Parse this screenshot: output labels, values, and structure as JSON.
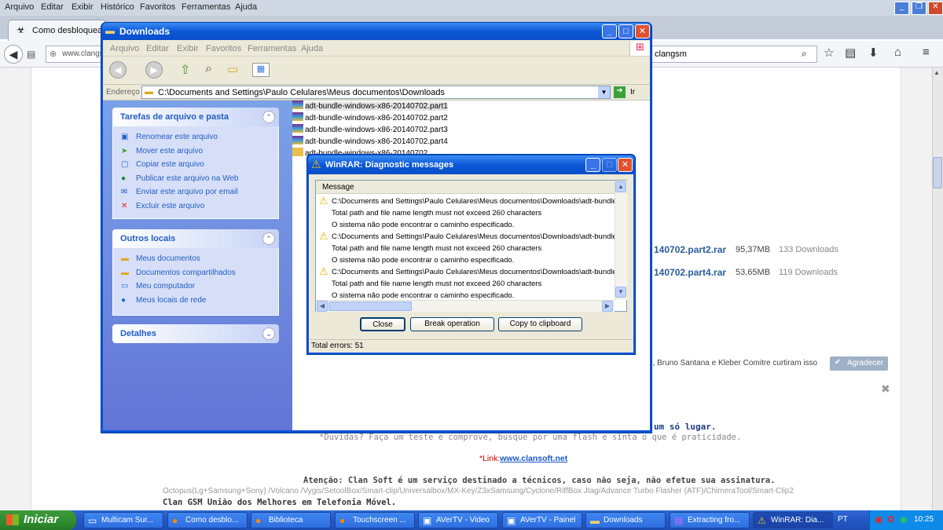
{
  "firefox": {
    "menu": [
      "Arquivo",
      "Editar",
      "Exibir",
      "Histórico",
      "Favoritos",
      "Ferramentas",
      "Ajuda"
    ],
    "tab_title": "Como desbloquear o",
    "url": "www.clangs",
    "search_value": "clangsm",
    "downloads": [
      {
        "name": "140702.part2.rar",
        "size": "95,37MB",
        "count": "133 Downloads"
      },
      {
        "name": "140702.part4.rar",
        "size": "53,65MB",
        "count": "119 Downloads"
      }
    ],
    "likes": "es, Bruno Santana e Kleber Comitre curtiram isso",
    "agradecer": "Agradecer",
    "page_lines": {
      "line1_tail": "um só lugar.",
      "line2": "*Duvidas? Faça um teste e comprove, busque por uma flash e sinta o que é praticidade.",
      "link_label": "*Link:",
      "link_url": "www.clansoft.net",
      "atencao": "Atenção: Clan Soft é um serviço destinado a técnicos, caso não seja, não efetue sua assinatura.",
      "tools": "Octopus(Lg+Samsung+Sony) /Volcano /Vygis/SetoolBox/Smart-clip/Universalbox/MX-Key/Z3xSamsung/Cyclone/RiffBox Jtag/Advance Turbo Flasher (ATF)/ChimeraTool/Smart-Clip2",
      "uniao": "Clan GSM União dos Melhores em Telefonia Móvel."
    }
  },
  "explorer": {
    "title": "Downloads",
    "menu": [
      "Arquivo",
      "Editar",
      "Exibir",
      "Favoritos",
      "Ferramentas",
      "Ajuda"
    ],
    "address_label": "Endereço",
    "address": "C:\\Documents and Settings\\Paulo Celulares\\Meus documentos\\Downloads",
    "go_label": "Ir",
    "tasks_title": "Tarefas de arquivo e pasta",
    "tasks": [
      "Renomear este arquivo",
      "Mover este arquivo",
      "Copiar este arquivo",
      "Publicar este arquivo na Web",
      "Enviar este arquivo por email",
      "Excluir este arquivo"
    ],
    "places_title": "Outros locais",
    "places": [
      "Meus documentos",
      "Documentos compartilhados",
      "Meu computador",
      "Meus locais de rede"
    ],
    "details_title": "Detalhes",
    "files": [
      "adt-bundle-windows-x86-20140702.part1",
      "adt-bundle-windows-x86-20140702.part2",
      "adt-bundle-windows-x86-20140702.part3",
      "adt-bundle-windows-x86-20140702.part4",
      "adt-bundle-windows-x86-20140702"
    ]
  },
  "winrar": {
    "title": "WinRAR: Diagnostic messages",
    "column": "Message",
    "path_line": "C:\\Documents and Settings\\Paulo Celulares\\Meus documentos\\Downloads\\adt-bundle",
    "length_line": "Total path and file name length must not exceed 260 characters",
    "notfound_line": "O sistema não pode encontrar o caminho especificado.",
    "buttons": {
      "close": "Close",
      "break": "Break operation",
      "copy": "Copy to clipboard"
    },
    "status": "Total errors: 51"
  },
  "taskbar": {
    "start": "Iniciar",
    "items": [
      "Multicam Sur...",
      "Como desblo...",
      "Biblioteca",
      "Touchscreen ...",
      "AVerTV - Video",
      "AVerTV - Painel",
      "Downloads",
      "Extracting fro...",
      "WinRAR: Dia..."
    ],
    "lang": "PT",
    "time": "10:25"
  }
}
